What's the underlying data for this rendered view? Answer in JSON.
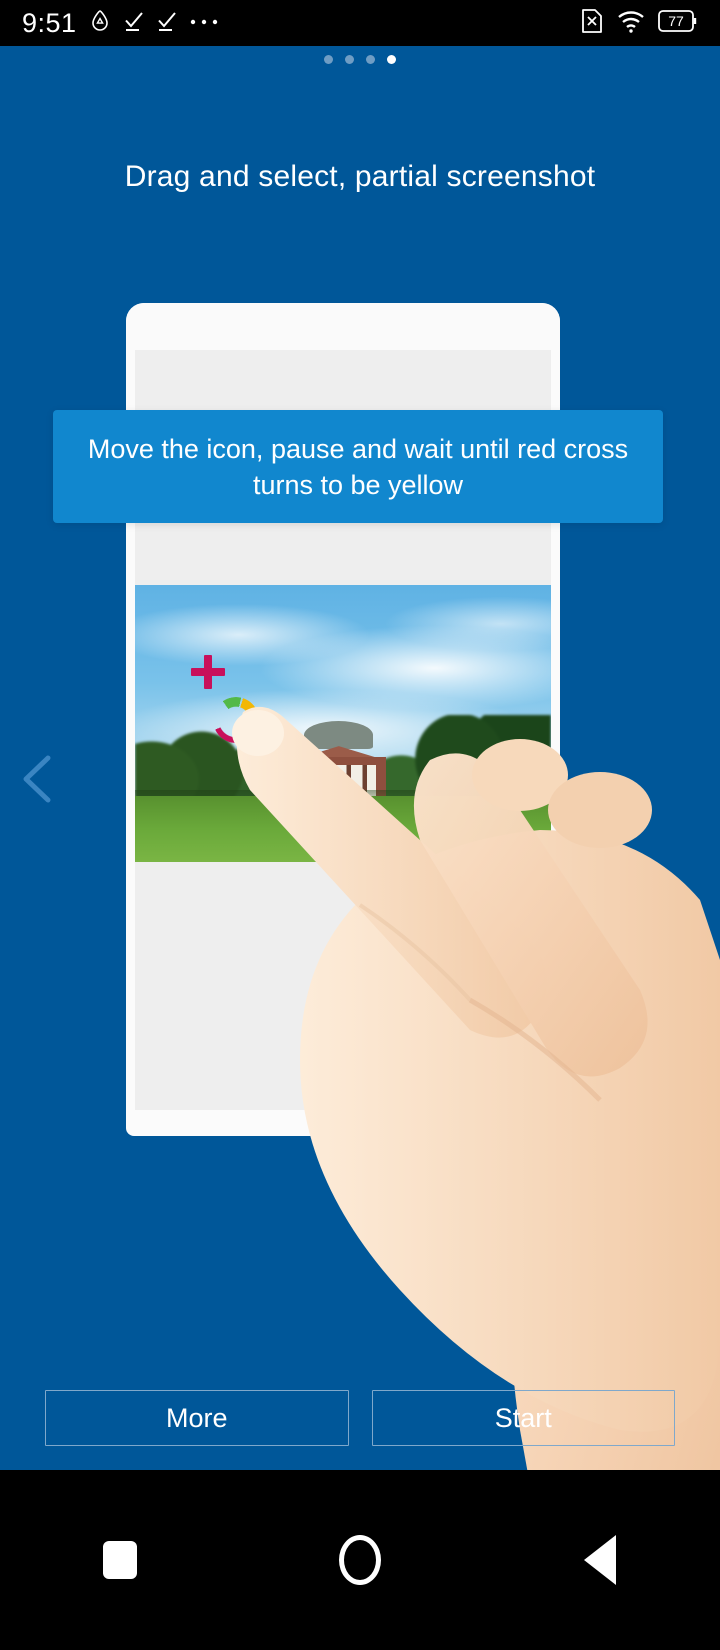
{
  "status_bar": {
    "time": "9:51",
    "left_icons": [
      "alert-triangle-icon",
      "check-download-icon",
      "check-download-icon",
      "more-dots-icon"
    ],
    "right_icons": [
      "sim-disabled-icon",
      "wifi-icon",
      "battery-icon"
    ],
    "battery_level": "77"
  },
  "pager": {
    "total": 4,
    "active_index": 3,
    "active_color": "#ffffff",
    "inactive_color": "#6f9dc4"
  },
  "header": {
    "title": "Drag and select, partial screenshot"
  },
  "tooltip": {
    "text": "Move the icon, pause and wait until red cross turns to be yellow",
    "background": "#1187ce",
    "text_color": "#ffffff"
  },
  "illustration": {
    "card_name": "phone-mock-card",
    "photo_description": "campus lawn with domed brick auditorium",
    "markers": [
      {
        "name": "crosshair-plus-marker",
        "color": "#c8105b"
      },
      {
        "name": "color-ring-marker",
        "colors": [
          "#c8105b",
          "#53b948",
          "#f2b705",
          "#2196d6"
        ]
      }
    ],
    "hand_name": "pointing-hand-illustration"
  },
  "nav_hint": {
    "back_chevron": "chevron-left-icon",
    "color": "#3a85c2"
  },
  "footer": {
    "more_label": "More",
    "start_label": "Start",
    "border_color": "#7fa8cb"
  },
  "system_nav": {
    "recents_label": "recents-square-icon",
    "home_label": "home-circle-icon",
    "back_label": "back-triangle-icon"
  },
  "theme": {
    "page_background": "#005799",
    "accent": "#1187ce"
  }
}
